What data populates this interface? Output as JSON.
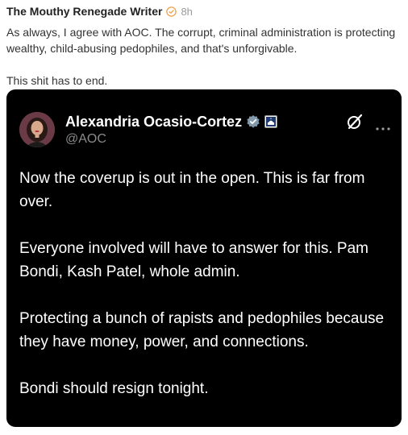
{
  "post": {
    "author": "The Mouthy Renegade Writer",
    "time": "8h",
    "paragraphs": [
      "As always, I agree with AOC. The corrupt, criminal administration is protecting wealthy, child-abusing pedophiles, and that's unforgivable.",
      "This shit has to end."
    ]
  },
  "embed": {
    "name": "Alexandria Ocasio-Cortez",
    "handle": "@AOC",
    "paragraphs": [
      "Now the coverup is out in the open. This is far from over.",
      "Everyone involved will have to answer for this. Pam Bondi, Kash Patel, whole admin.",
      "Protecting a bunch of rapists and pedophiles because they have money, power, and connections.",
      "Bondi should resign tonight."
    ]
  },
  "icons": {
    "author_badge": "verified-check-icon",
    "embed_badge": "gray-verified-badge-icon",
    "affiliation": "capitol-affiliation-icon",
    "grok": "grok-icon",
    "more": "more-options-icon"
  },
  "colors": {
    "verified_orange": "#f0a14a",
    "embed_background": "#000000",
    "gray_badge": "#829aab"
  }
}
